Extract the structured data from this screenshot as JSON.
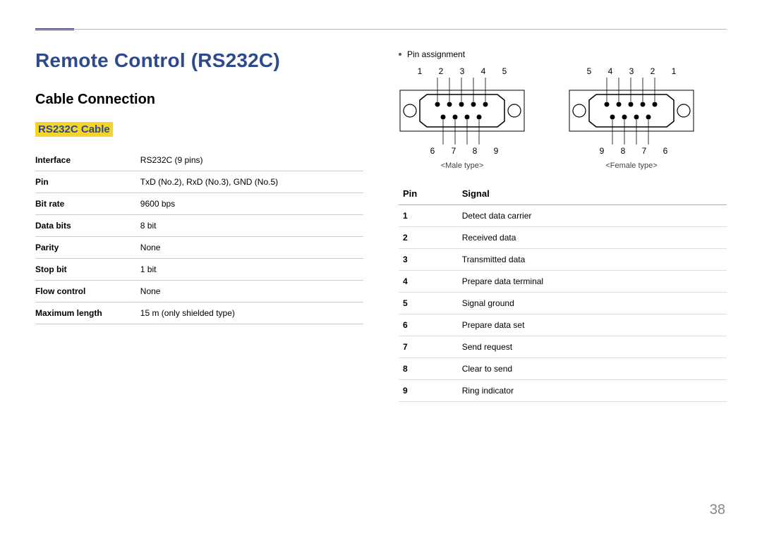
{
  "page_number": "38",
  "title": "Remote Control (RS232C)",
  "subtitle": "Cable Connection",
  "cable_label": "RS232C Cable",
  "spec_table": [
    {
      "k": "Interface",
      "v": "RS232C (9 pins)"
    },
    {
      "k": "Pin",
      "v": "TxD (No.2), RxD (No.3), GND (No.5)"
    },
    {
      "k": "Bit rate",
      "v": "9600 bps"
    },
    {
      "k": "Data bits",
      "v": "8 bit"
    },
    {
      "k": "Parity",
      "v": "None"
    },
    {
      "k": "Stop bit",
      "v": "1 bit"
    },
    {
      "k": "Flow control",
      "v": "None"
    },
    {
      "k": "Maximum length",
      "v": "15 m (only shielded type)"
    }
  ],
  "pin_assignment_label": "Pin assignment",
  "connectors": {
    "male": {
      "top_pins": "1  2  3  4  5",
      "bottom_pins": "6  7  8  9",
      "label": "<Male type>"
    },
    "female": {
      "top_pins": "5  4  3  2  1",
      "bottom_pins": "9  8  7  6",
      "label": "<Female type>"
    }
  },
  "signal_table": {
    "headers": {
      "pin": "Pin",
      "signal": "Signal"
    },
    "rows": [
      {
        "pin": "1",
        "sig": "Detect data carrier"
      },
      {
        "pin": "2",
        "sig": "Received data"
      },
      {
        "pin": "3",
        "sig": "Transmitted data"
      },
      {
        "pin": "4",
        "sig": "Prepare data terminal"
      },
      {
        "pin": "5",
        "sig": "Signal ground"
      },
      {
        "pin": "6",
        "sig": "Prepare data set"
      },
      {
        "pin": "7",
        "sig": "Send request"
      },
      {
        "pin": "8",
        "sig": "Clear to send"
      },
      {
        "pin": "9",
        "sig": "Ring indicator"
      }
    ]
  }
}
